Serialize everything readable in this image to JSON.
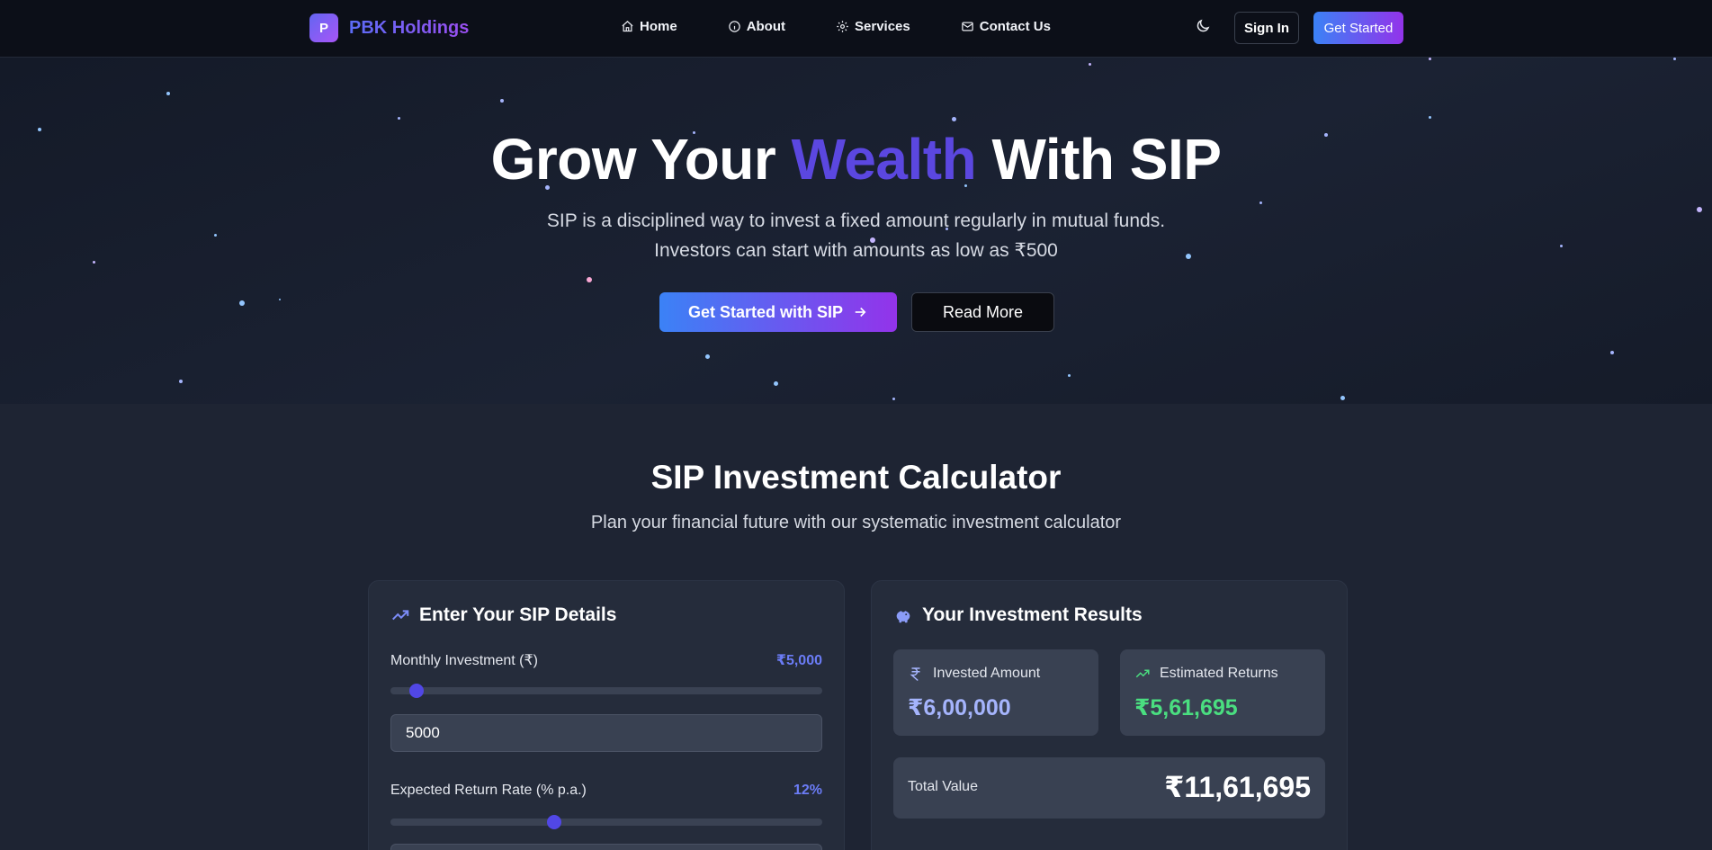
{
  "nav": {
    "brand_letter": "P",
    "brand_name": "PBK Holdings",
    "links": [
      {
        "label": "Home",
        "icon": "home-icon"
      },
      {
        "label": "About",
        "icon": "info-icon"
      },
      {
        "label": "Services",
        "icon": "gear-icon"
      },
      {
        "label": "Contact Us",
        "icon": "mail-icon"
      }
    ],
    "theme_icon": "moon-icon",
    "signin_label": "Sign In",
    "getstarted_label": "Get Started"
  },
  "hero": {
    "title_before": "Grow Your ",
    "title_accent": "Wealth",
    "title_after": " With SIP",
    "subtitle_line1": "SIP is a disciplined way to invest a fixed amount regularly in mutual funds.",
    "subtitle_line2": "Investors can start with amounts as low as ₹500",
    "primary_button": "Get Started with SIP",
    "secondary_button": "Read More"
  },
  "calculator": {
    "title": "SIP Investment Calculator",
    "subtitle": "Plan your financial future with our systematic investment calculator",
    "input_card": {
      "heading": "Enter Your SIP Details",
      "monthly_label": "Monthly Investment (₹)",
      "monthly_display": "₹5,000",
      "monthly_value": "5000",
      "monthly_slider_pct": 0.06,
      "rate_label": "Expected Return Rate (% p.a.)",
      "rate_display": "12%",
      "rate_slider_pct": 0.38
    },
    "results_card": {
      "heading": "Your Investment Results",
      "invested_label": "Invested Amount",
      "invested_value": "₹6,00,000",
      "returns_label": "Estimated Returns",
      "returns_value": "₹5,61,695",
      "total_label": "Total Value",
      "total_value": "₹11,61,695"
    }
  },
  "colors": {
    "accent": "#5b47e0",
    "invested": "#a5b4fc",
    "returns": "#4ade80"
  }
}
